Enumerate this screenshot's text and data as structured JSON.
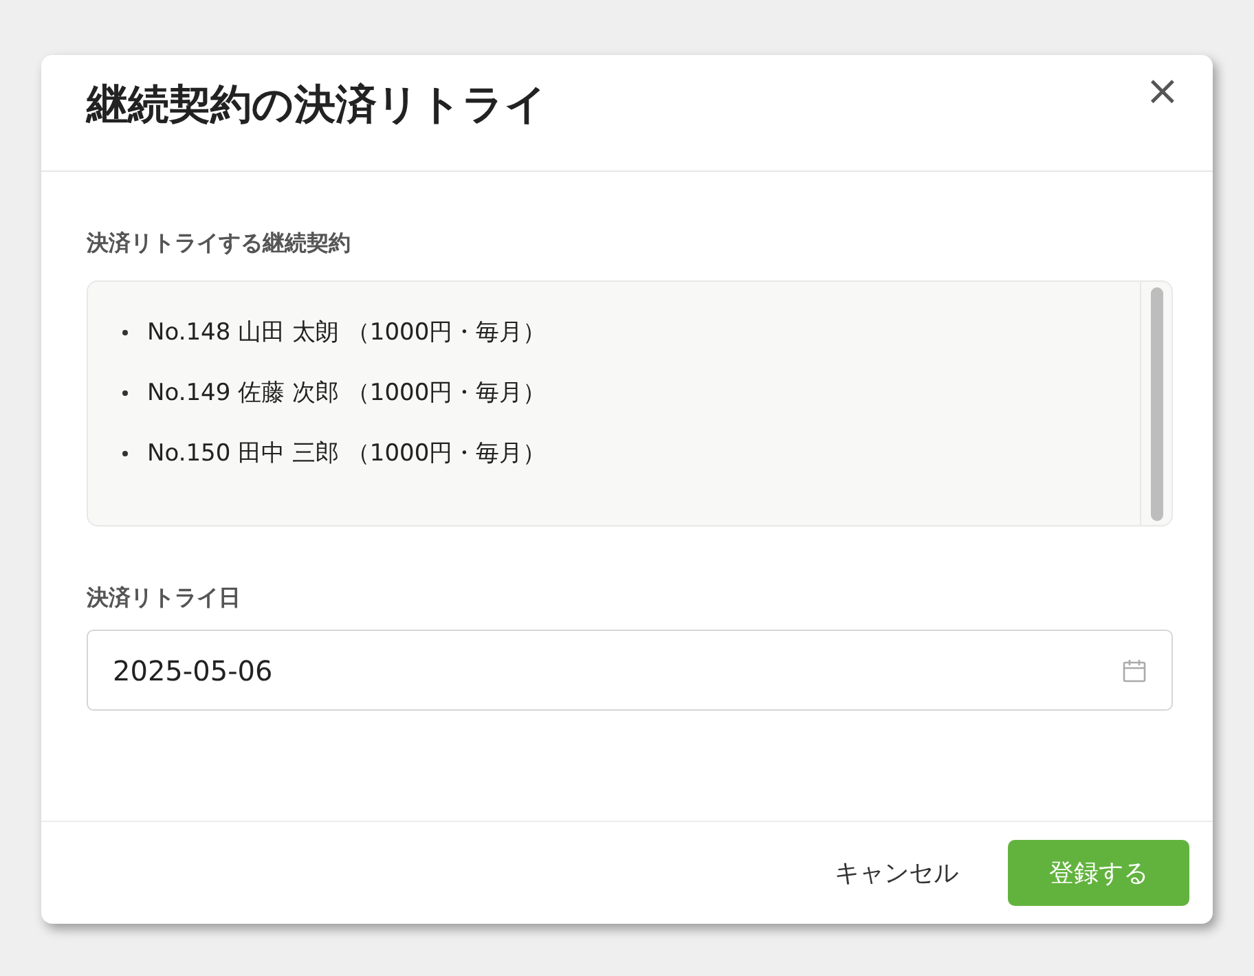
{
  "dialog": {
    "title": "継続契約の決済リトライ",
    "close": "×"
  },
  "contracts": {
    "label": "決済リトライする継続契約",
    "items": [
      {
        "text": "No.148 山田 太朗 （1000円・毎月）"
      },
      {
        "text": "No.149 佐藤 次郎 （1000円・毎月）"
      },
      {
        "text": "No.150 田中 三郎 （1000円・毎月）"
      }
    ]
  },
  "retry_date": {
    "label": "決済リトライ日",
    "value": "2025-05-06"
  },
  "buttons": [
    {
      "label": "キャンセル",
      "kind": "text"
    },
    {
      "label": "登録する",
      "kind": "primary"
    }
  ]
}
